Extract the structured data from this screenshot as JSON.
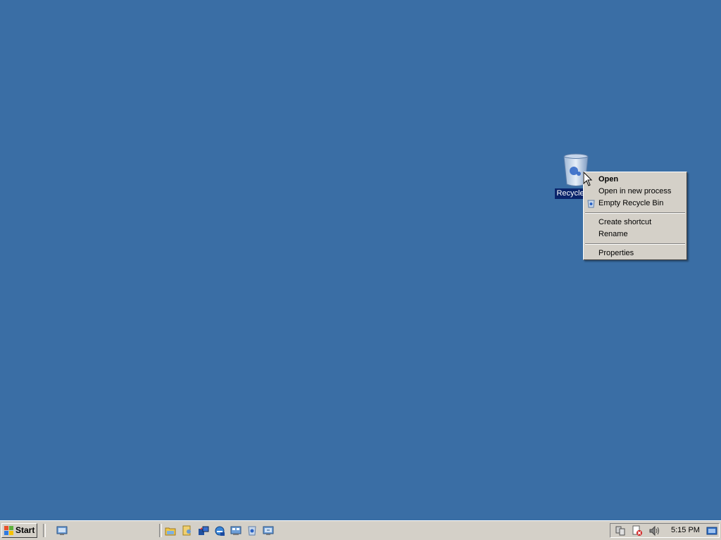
{
  "desktop": {
    "background": "#3a6ea5",
    "icons": [
      {
        "label": "Recycle",
        "icon": "recycle-bin-icon"
      }
    ]
  },
  "context_menu": {
    "items": [
      {
        "label": "Open",
        "bold": true
      },
      {
        "label": "Open in new process"
      },
      {
        "label": "Empty Recycle Bin",
        "icon": "empty-recycle-bin-icon"
      },
      {
        "label": "Create shortcut"
      },
      {
        "label": "Rename"
      },
      {
        "label": "Properties"
      }
    ]
  },
  "taskbar": {
    "start_label": "Start",
    "quick_launch": [
      "show-desktop-icon",
      "explorer-icon",
      "user-icon",
      "server-manager-icon",
      "internet-explorer-icon",
      "console-icon",
      "recycle-icon",
      "remote-desktop-icon"
    ],
    "tray": {
      "icons": [
        "network-icon",
        "security-alert-icon",
        "volume-icon"
      ],
      "clock": "5:15 PM"
    }
  }
}
